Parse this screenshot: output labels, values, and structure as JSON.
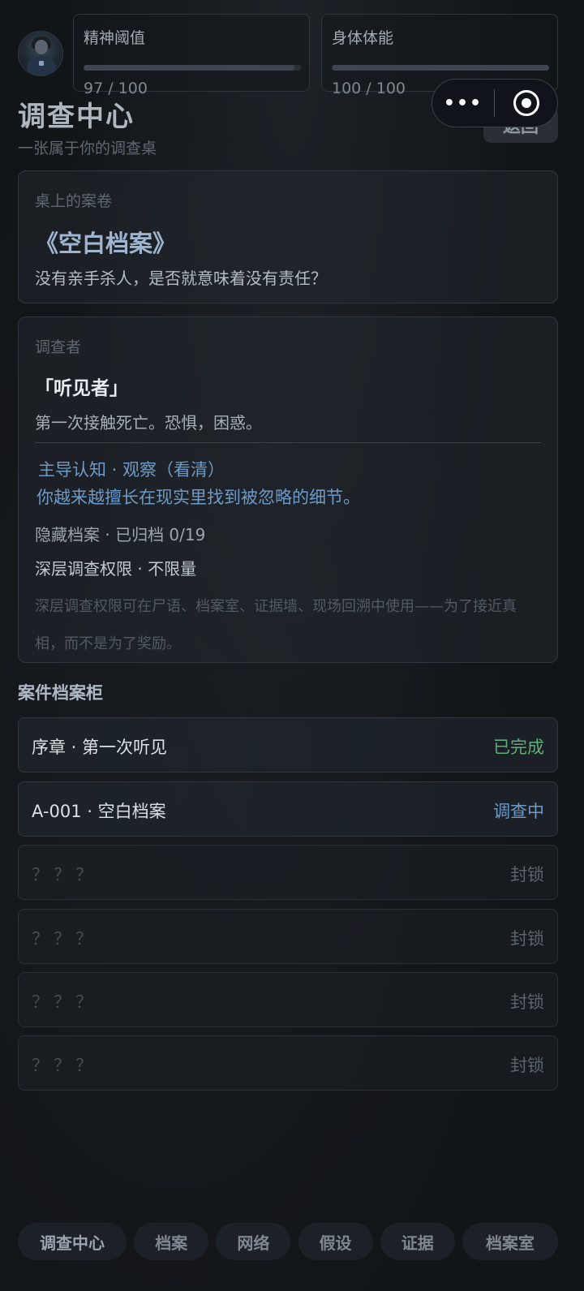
{
  "stats": {
    "mind": {
      "label": "精神阈值",
      "value_text": "97 / 100",
      "fill": 0.97
    },
    "body": {
      "label": "身体体能",
      "value_text": "100 / 100",
      "fill": 1.0
    }
  },
  "capsule": {
    "more": "•••"
  },
  "header": {
    "title": "调查中心",
    "subtitle": "一张属于你的调查桌",
    "back_label": "返回"
  },
  "case": {
    "caption": "桌上的案卷",
    "title": "《空白档案》",
    "question": "没有亲手杀人，是否就意味着没有责任？"
  },
  "investigator": {
    "caption": "调查者",
    "name": "「听见者」",
    "desc": "第一次接触死亡。恐惧，困惑。",
    "cognition": "主导认知 · 观察（看清）",
    "cognition_desc": "你越来越擅长在现实里找到被忽略的细节。",
    "hidden": "隐藏档案 · 已归档 0/19",
    "deep": "深层调查权限 · 不限量",
    "note": "深层调查权限可在尸语、档案室、证据墙、现场回溯中使用——为了接近真相，而不是为了奖励。"
  },
  "cabinet": {
    "title": "案件档案柜",
    "rows": [
      {
        "name": "序章 · 第一次听见",
        "status": "已完成",
        "state": "done"
      },
      {
        "name": "A-001 · 空白档案",
        "status": "调查中",
        "state": "active"
      },
      {
        "name": "？？？",
        "status": "封锁",
        "state": "locked"
      },
      {
        "name": "？？？",
        "status": "封锁",
        "state": "locked"
      },
      {
        "name": "？？？",
        "status": "封锁",
        "state": "locked"
      },
      {
        "name": "？？？",
        "status": "封锁",
        "state": "locked"
      }
    ]
  },
  "tabs": [
    {
      "label": "调查中心"
    },
    {
      "label": "档案"
    },
    {
      "label": "网络"
    },
    {
      "label": "假设"
    },
    {
      "label": "证据"
    },
    {
      "label": "档案室"
    }
  ]
}
